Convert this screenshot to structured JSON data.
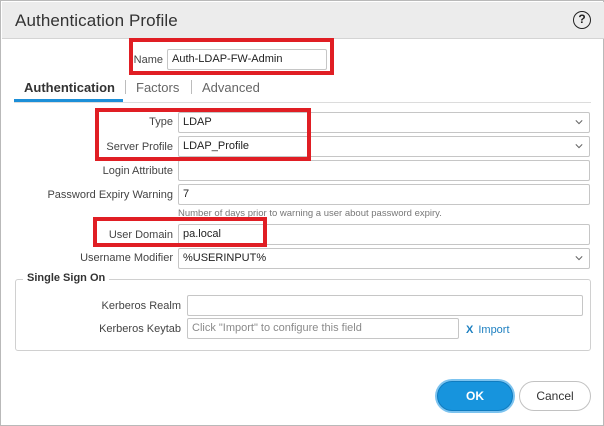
{
  "dialog": {
    "title": "Authentication Profile",
    "help_icon": "help-question-icon",
    "help_glyph": "?"
  },
  "name": {
    "label": "Name",
    "value": "Auth-LDAP-FW-Admin"
  },
  "tabs": [
    {
      "label": "Authentication",
      "active": true
    },
    {
      "label": "Factors",
      "active": false
    },
    {
      "label": "Advanced",
      "active": false
    }
  ],
  "form": {
    "type": {
      "label": "Type",
      "value": "LDAP"
    },
    "server_profile": {
      "label": "Server Profile",
      "value": "LDAP_Profile"
    },
    "login_attribute": {
      "label": "Login Attribute",
      "value": ""
    },
    "password_expiry": {
      "label": "Password Expiry Warning",
      "value": "7",
      "hint": "Number of days prior to warning a user about password expiry."
    },
    "user_domain": {
      "label": "User Domain",
      "value": "pa.local"
    },
    "username_modifier": {
      "label": "Username Modifier",
      "value": "%USERINPUT%"
    }
  },
  "sso": {
    "legend": "Single Sign On",
    "kerberos_realm": {
      "label": "Kerberos Realm",
      "value": ""
    },
    "kerberos_keytab": {
      "label": "Kerberos Keytab",
      "placeholder": "Click \"Import\" to configure this field"
    },
    "import_glyph": "X",
    "import_label": "Import"
  },
  "buttons": {
    "ok": "OK",
    "cancel": "Cancel"
  },
  "colors": {
    "accent": "#1794dd",
    "highlight_box": "#e01e24",
    "titlebar": "#ececec"
  }
}
